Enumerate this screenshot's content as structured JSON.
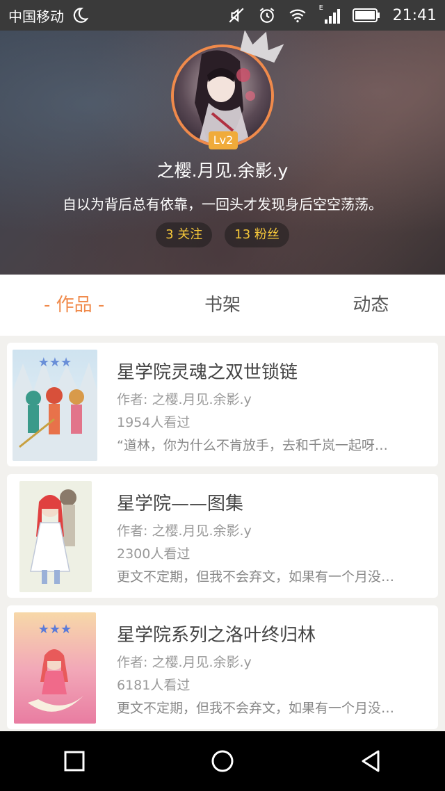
{
  "status_bar": {
    "carrier": "中国移动",
    "time": "21:41",
    "network_label": "E"
  },
  "profile": {
    "level": "Lv2",
    "nickname": "之樱.月见.余影.y",
    "signature": "自以为背后总有依靠，一回头才发现身后空空荡荡。",
    "following": "3 关注",
    "followers": "13 粉丝"
  },
  "tabs": [
    {
      "label": "- 作品 -",
      "active": true
    },
    {
      "label": "书架",
      "active": false
    },
    {
      "label": "动态",
      "active": false
    }
  ],
  "works": [
    {
      "title": "星学院灵魂之双世锁链",
      "author": "作者: 之樱.月见.余影.y",
      "views": "1954人看过",
      "excerpt": "“道林，你为什么不肯放手，去和千岚一起呀…"
    },
    {
      "title": "星学院——图集",
      "author": "作者: 之樱.月见.余影.y",
      "views": "2300人看过",
      "excerpt": "更文不定期，但我不会弃文，如果有一个月没…"
    },
    {
      "title": "星学院系列之洛叶终归林",
      "author": "作者: 之樱.月见.余影.y",
      "views": "6181人看过",
      "excerpt": "更文不定期，但我不会弃文，如果有一个月没…"
    }
  ],
  "colors": {
    "accent": "#f08a4b",
    "level_badge": "#f0ab3a",
    "stat_text": "#f6c83a"
  },
  "icons": [
    "moon-icon",
    "mute-icon",
    "alarm-icon",
    "wifi-icon",
    "signal-icon",
    "battery-icon",
    "crown-icon",
    "square-nav-icon",
    "circle-nav-icon",
    "triangle-nav-icon"
  ]
}
